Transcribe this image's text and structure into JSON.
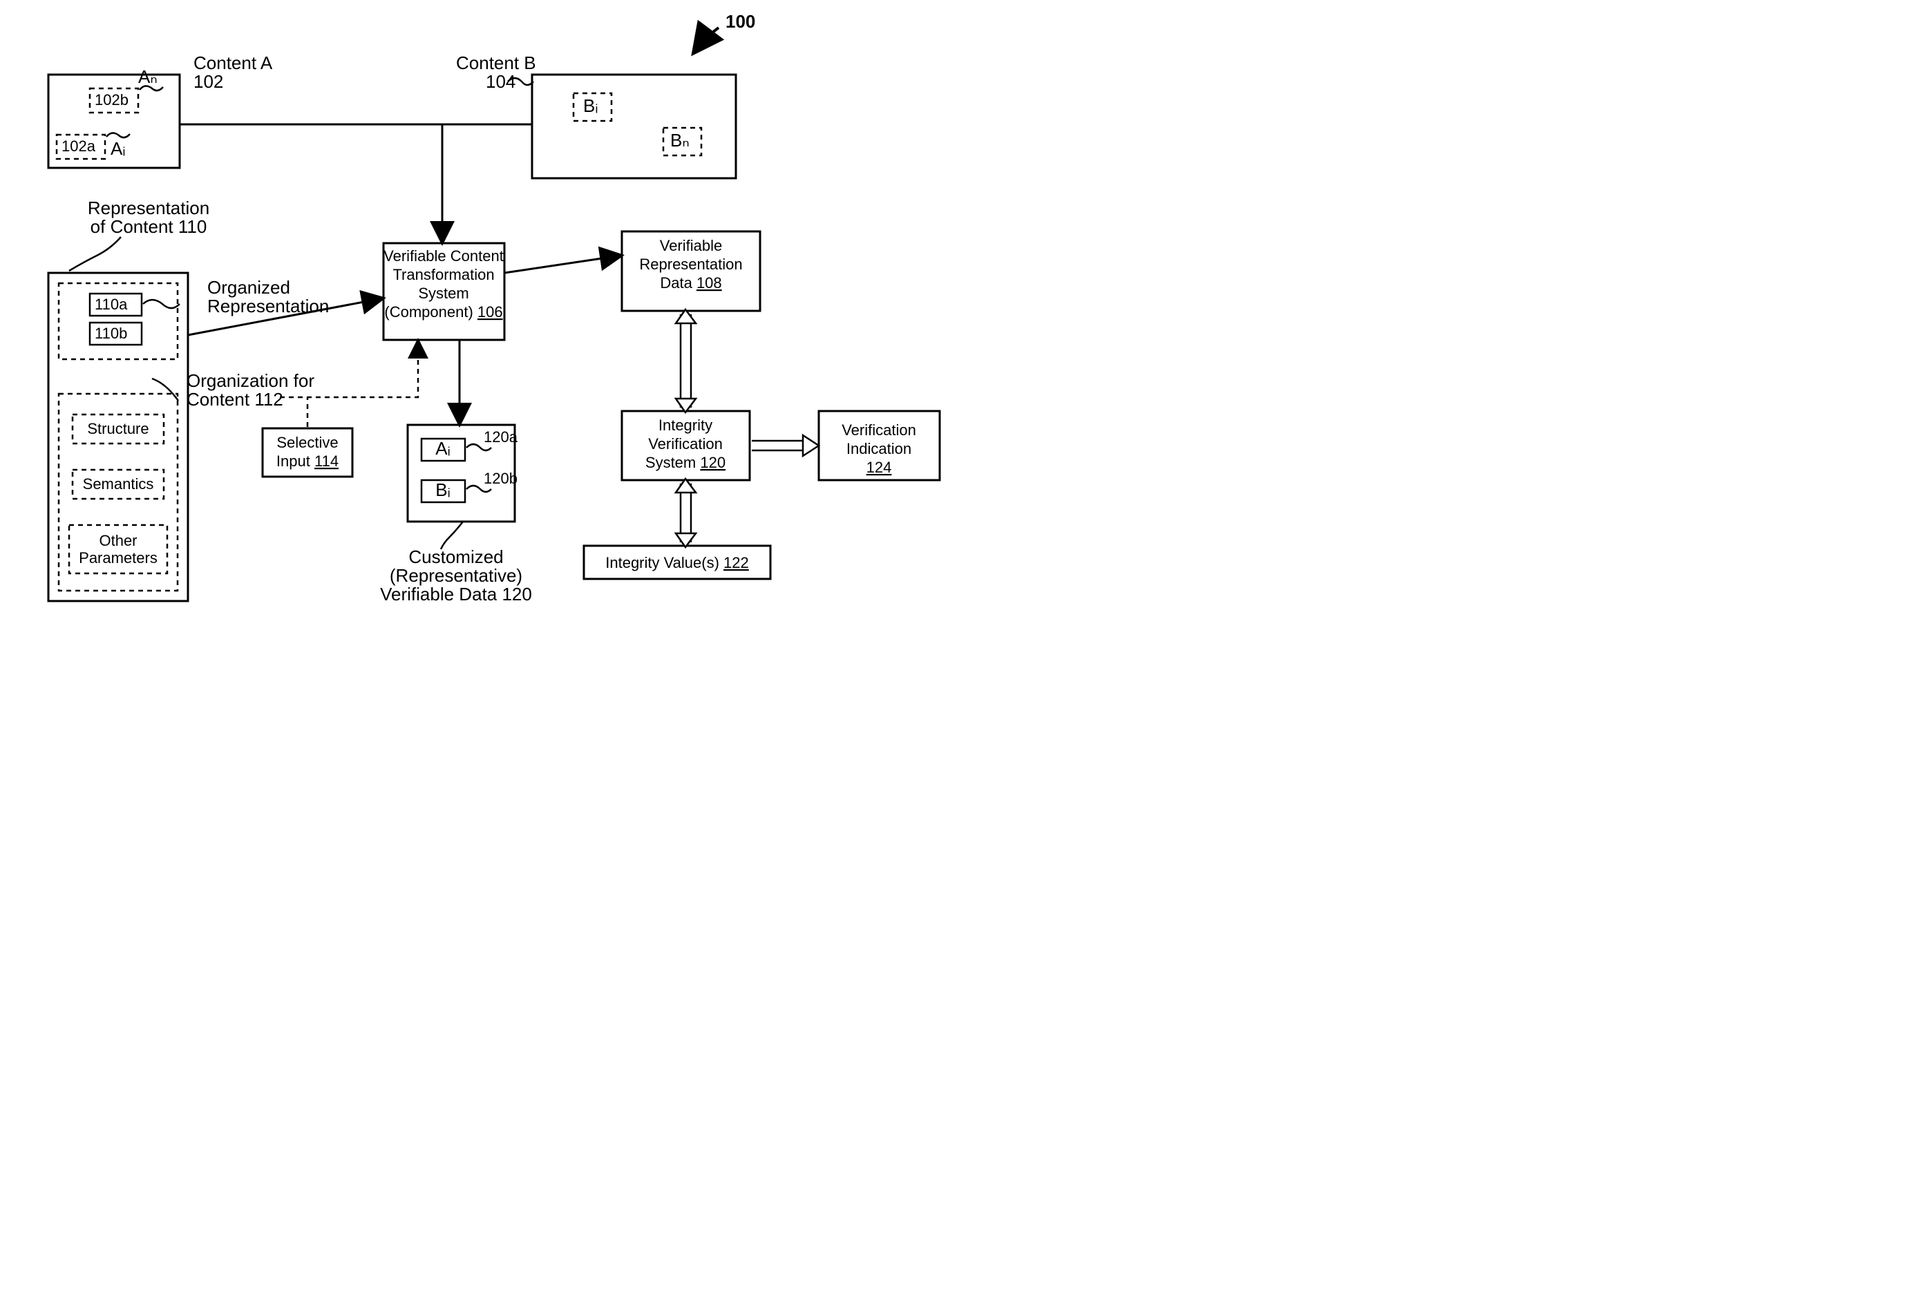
{
  "figure_ref": "100",
  "content_a": {
    "label": "Content A",
    "ref": "102",
    "sub_a_ref": "102a",
    "sub_b_ref": "102b",
    "item_i": "Aᵢ",
    "item_n": "Aₙ"
  },
  "content_b": {
    "label": "Content B",
    "ref": "104",
    "item_i": "Bᵢ",
    "item_n": "Bₙ"
  },
  "transform": {
    "l1": "Verifiable Content",
    "l2": "Transformation",
    "l3": "System",
    "l4": "(Component)",
    "ref": "106"
  },
  "verifiable_rep": {
    "l1": "Verifiable",
    "l2": "Representation",
    "l3": "Data",
    "ref": "108"
  },
  "rep_of_content": {
    "l1": "Representation",
    "l2": "of Content",
    "ref": "110",
    "sub_a": "110a",
    "sub_b": "110b",
    "org_label": "Organized",
    "org_label2": "Representation"
  },
  "org_for_content": {
    "l1": "Organization for",
    "l2": "Content",
    "ref": "112",
    "structure": "Structure",
    "semantics": "Semantics",
    "other1": "Other",
    "other2": "Parameters"
  },
  "selective_input": {
    "l1": "Selective",
    "l2": "Input",
    "ref": "114"
  },
  "customized": {
    "l1": "Customized",
    "l2": "(Representative)",
    "l3": "Verifiable Data",
    "ref": "120",
    "ai": "Aᵢ",
    "bi": "Bᵢ",
    "ai_ref": "120a",
    "bi_ref": "120b"
  },
  "integrity_sys": {
    "l1": "Integrity",
    "l2": "Verification",
    "l3": "System",
    "ref": "120"
  },
  "integrity_values": {
    "label": "Integrity Value(s)",
    "ref": "122"
  },
  "verification_ind": {
    "l1": "Verification",
    "l2": "Indication",
    "ref": "124"
  }
}
